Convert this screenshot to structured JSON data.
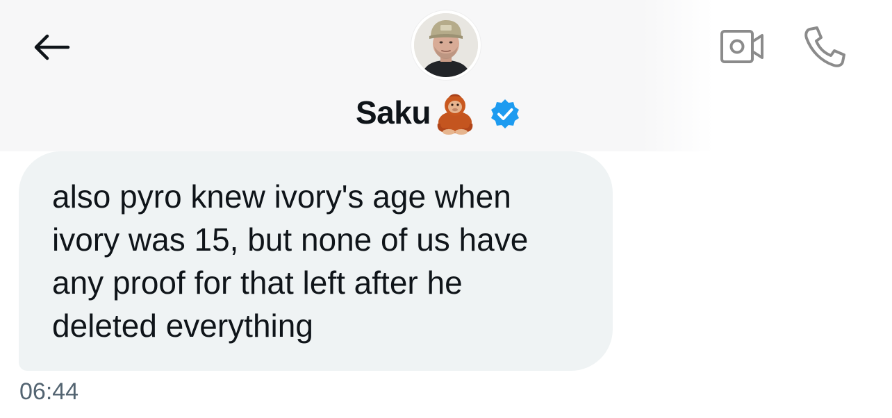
{
  "header": {
    "contact": {
      "name": "Saku",
      "name_emoji": "orangutan-emoji",
      "verified": true,
      "verified_color": "#1d9bf0"
    },
    "icons": {
      "back": "arrow-left-icon",
      "video": "video-camera-icon",
      "call": "phone-icon"
    }
  },
  "conversation": {
    "messages": [
      {
        "direction": "received",
        "text": "also pyro knew ivory's age when\nivory was 15, but none of us have\nany proof for that left after he\ndeleted everything",
        "time": "06:44"
      }
    ]
  },
  "colors": {
    "header_bg": "#f7f7f8",
    "bubble_bg": "#eff3f4",
    "text_primary": "#0f1419",
    "text_secondary": "#536471",
    "icon_gray": "#8b8b8b"
  }
}
